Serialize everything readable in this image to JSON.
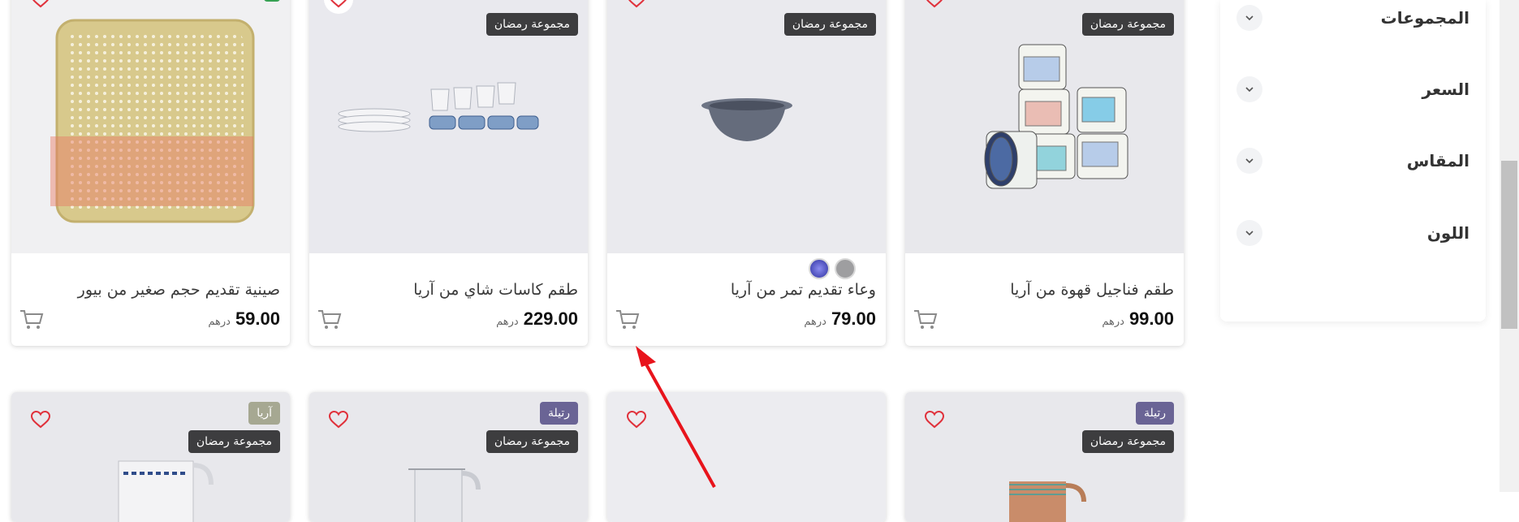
{
  "sidebar": {
    "filters": [
      {
        "label": "المجموعات"
      },
      {
        "label": "السعر"
      },
      {
        "label": "المقاس"
      },
      {
        "label": "اللون"
      }
    ]
  },
  "products_top": [
    {
      "title": "طقم فناجيل قهوة من آريا",
      "price": "99.00",
      "currency": "درهم",
      "badge": "مجموعة رمضان",
      "image": "coffee-cups-image"
    },
    {
      "title": "وعاء تقديم تمر من آريا",
      "price": "79.00",
      "currency": "درهم",
      "badge": "مجموعة رمضان",
      "image": "date-bowl-image",
      "swatches": [
        "#9e9ea0",
        "#5658b8"
      ]
    },
    {
      "title": "طقم كاسات شاي من آريا",
      "price": "229.00",
      "currency": "درهم",
      "badge": "مجموعة رمضان",
      "image": "tea-glasses-image"
    },
    {
      "title": "صينية تقديم حجم صغير من بيور",
      "price": "59.00",
      "currency": "درهم",
      "badge": "",
      "image": "serving-tray-image"
    }
  ],
  "products_bottom": [
    {
      "badges": [
        "رتيلة",
        "مجموعة رمضان"
      ],
      "image": "woven-jug-image"
    },
    {
      "badges": [],
      "image": "product-image"
    },
    {
      "badges": [
        "رتيلة",
        "مجموعة رمضان"
      ],
      "image": "white-jug-image"
    },
    {
      "badges": [
        "آريا",
        "مجموعة رمضان"
      ],
      "image": "pattern-jug-image"
    }
  ],
  "colors": {
    "badge_dark": "#3d3d3f",
    "badge_olive": "#a6a892",
    "badge_purple": "#6a6495",
    "badge_green": "#36a153",
    "heart": "#e0313b",
    "annotation_arrow": "#e8141c"
  }
}
